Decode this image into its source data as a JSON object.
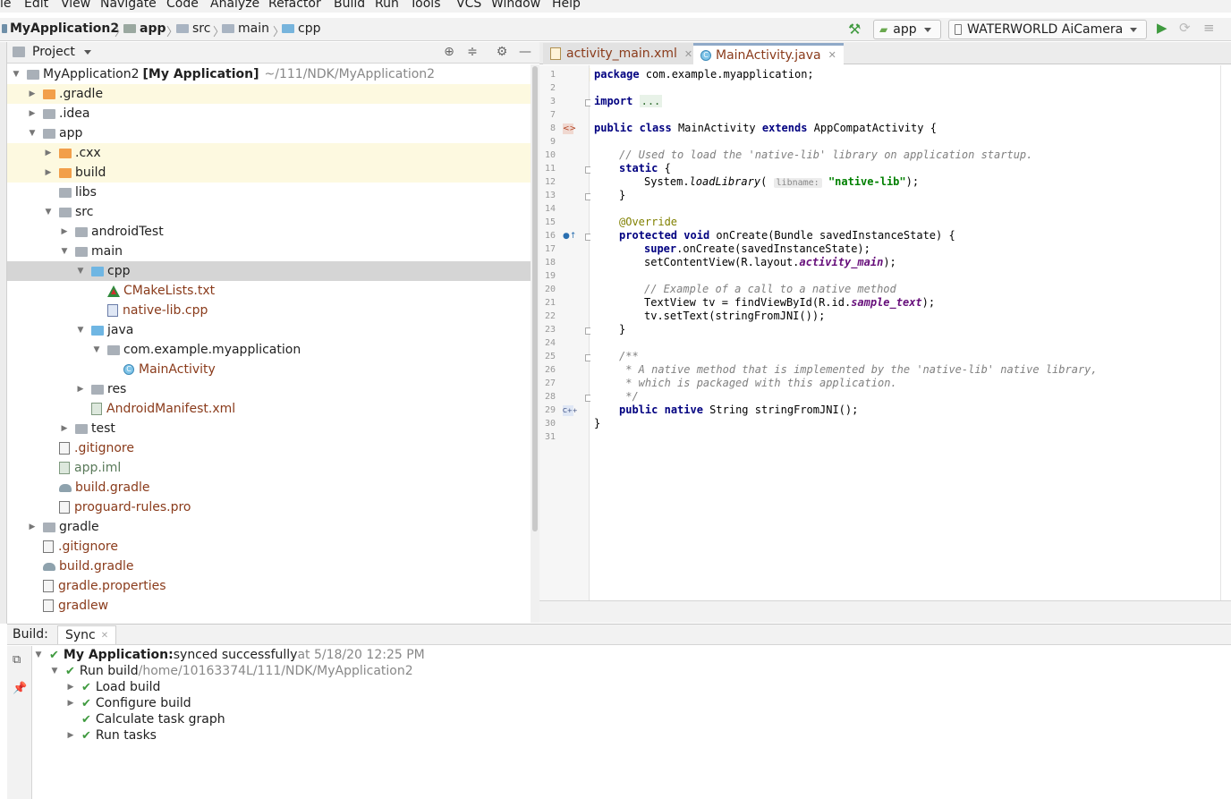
{
  "menu": [
    "le",
    "Edit",
    "View",
    "Navigate",
    "Code",
    "Analyze",
    "Refactor",
    "Build",
    "Run",
    "Tools",
    "VCS",
    "Window",
    "Help"
  ],
  "breadcrumbs": {
    "project": "MyApplication2",
    "module": "app",
    "src": "src",
    "main": "main",
    "cpp": "cpp"
  },
  "toolbar": {
    "run_config": "app",
    "device": "WATERWORLD AiCamera"
  },
  "project_panel": {
    "title": "Project",
    "tree": [
      {
        "label": "MyApplication2",
        "suffix": "[My Application]",
        "path": "~/111/NDK/MyApplication2"
      },
      {
        "label": ".gradle"
      },
      {
        "label": ".idea"
      },
      {
        "label": "app"
      },
      {
        "label": ".cxx"
      },
      {
        "label": "build"
      },
      {
        "label": "libs"
      },
      {
        "label": "src"
      },
      {
        "label": "androidTest"
      },
      {
        "label": "main"
      },
      {
        "label": "cpp"
      },
      {
        "label": "CMakeLists.txt"
      },
      {
        "label": "native-lib.cpp"
      },
      {
        "label": "java"
      },
      {
        "label": "com.example.myapplication"
      },
      {
        "label": "MainActivity"
      },
      {
        "label": "res"
      },
      {
        "label": "AndroidManifest.xml"
      },
      {
        "label": "test"
      },
      {
        "label": ".gitignore"
      },
      {
        "label": "app.iml"
      },
      {
        "label": "build.gradle"
      },
      {
        "label": "proguard-rules.pro"
      },
      {
        "label": "gradle"
      },
      {
        "label": ".gitignore"
      },
      {
        "label": "build.gradle"
      },
      {
        "label": "gradle.properties"
      },
      {
        "label": "gradlew"
      }
    ]
  },
  "editor": {
    "tabs": [
      {
        "label": "activity_main.xml",
        "active": false
      },
      {
        "label": "MainActivity.java",
        "active": true
      }
    ],
    "code": {
      "l1_pkg": "package",
      "l1_rest": " com.example.myapplication;",
      "l3_import": "import",
      "l3_fold": "...",
      "l5_public": "public",
      "l5_class": "class",
      "l5_name": " MainActivity ",
      "l5_extends": "extends",
      "l5_rest": " AppCompatActivity {",
      "l7_comment": "// Used to load the 'native-lib' library on application startup.",
      "l8_static": "static",
      "l8_rest": " {",
      "l9_a": "System.",
      "l9_method": "loadLibrary",
      "l9_b": "(",
      "l9_hint": "libname:",
      "l9_str": "\"native-lib\"",
      "l9_c": ");",
      "l10": "}",
      "l12_ann": "@Override",
      "l13_protected": "protected",
      "l13_void": "void",
      "l13_rest": " onCreate(Bundle savedInstanceState) {",
      "l14_super": "super",
      "l14_rest": ".onCreate(savedInstanceState);",
      "l15_a": "setContentView(R.layout.",
      "l15_field": "activity_main",
      "l15_b": ");",
      "l17_comment": "// Example of a call to a native method",
      "l18_a": "TextView tv = findViewById(R.id.",
      "l18_field": "sample_text",
      "l18_b": ");",
      "l19": "tv.setText(stringFromJNI());",
      "l20": "}",
      "l22": "/**",
      "l23": " * A native method that is implemented by the 'native-lib' native library,",
      "l24": " * which is packaged with this application.",
      "l25": " */",
      "l26_public": "public",
      "l26_native": "native",
      "l26_rest": " String stringFromJNI();",
      "l27": "}"
    },
    "line_numbers": [
      "1",
      "2",
      "3",
      "7",
      "8",
      "9",
      "10",
      "11",
      "12",
      "13",
      "14",
      "15",
      "16",
      "17",
      "18",
      "19",
      "20",
      "21",
      "22",
      "23",
      "24",
      "25",
      "26",
      "27",
      "28",
      "29",
      "30",
      "31"
    ]
  },
  "build_panel": {
    "label": "Build:",
    "tab": "Sync",
    "rows": [
      {
        "bold": "My Application:",
        "text": " synced successfully",
        "muted": " at 5/18/20 12:25 PM"
      },
      {
        "text": "Run build",
        "muted": " /home/10163374L/111/NDK/MyApplication2"
      },
      {
        "text": "Load build"
      },
      {
        "text": "Configure build"
      },
      {
        "text": "Calculate task graph"
      },
      {
        "text": "Run tasks"
      }
    ]
  },
  "colors": {
    "accent_green": "#3f9a3f",
    "file_brown": "#8a3b1b",
    "keyword_navy": "#000080",
    "string_green": "#008000"
  }
}
